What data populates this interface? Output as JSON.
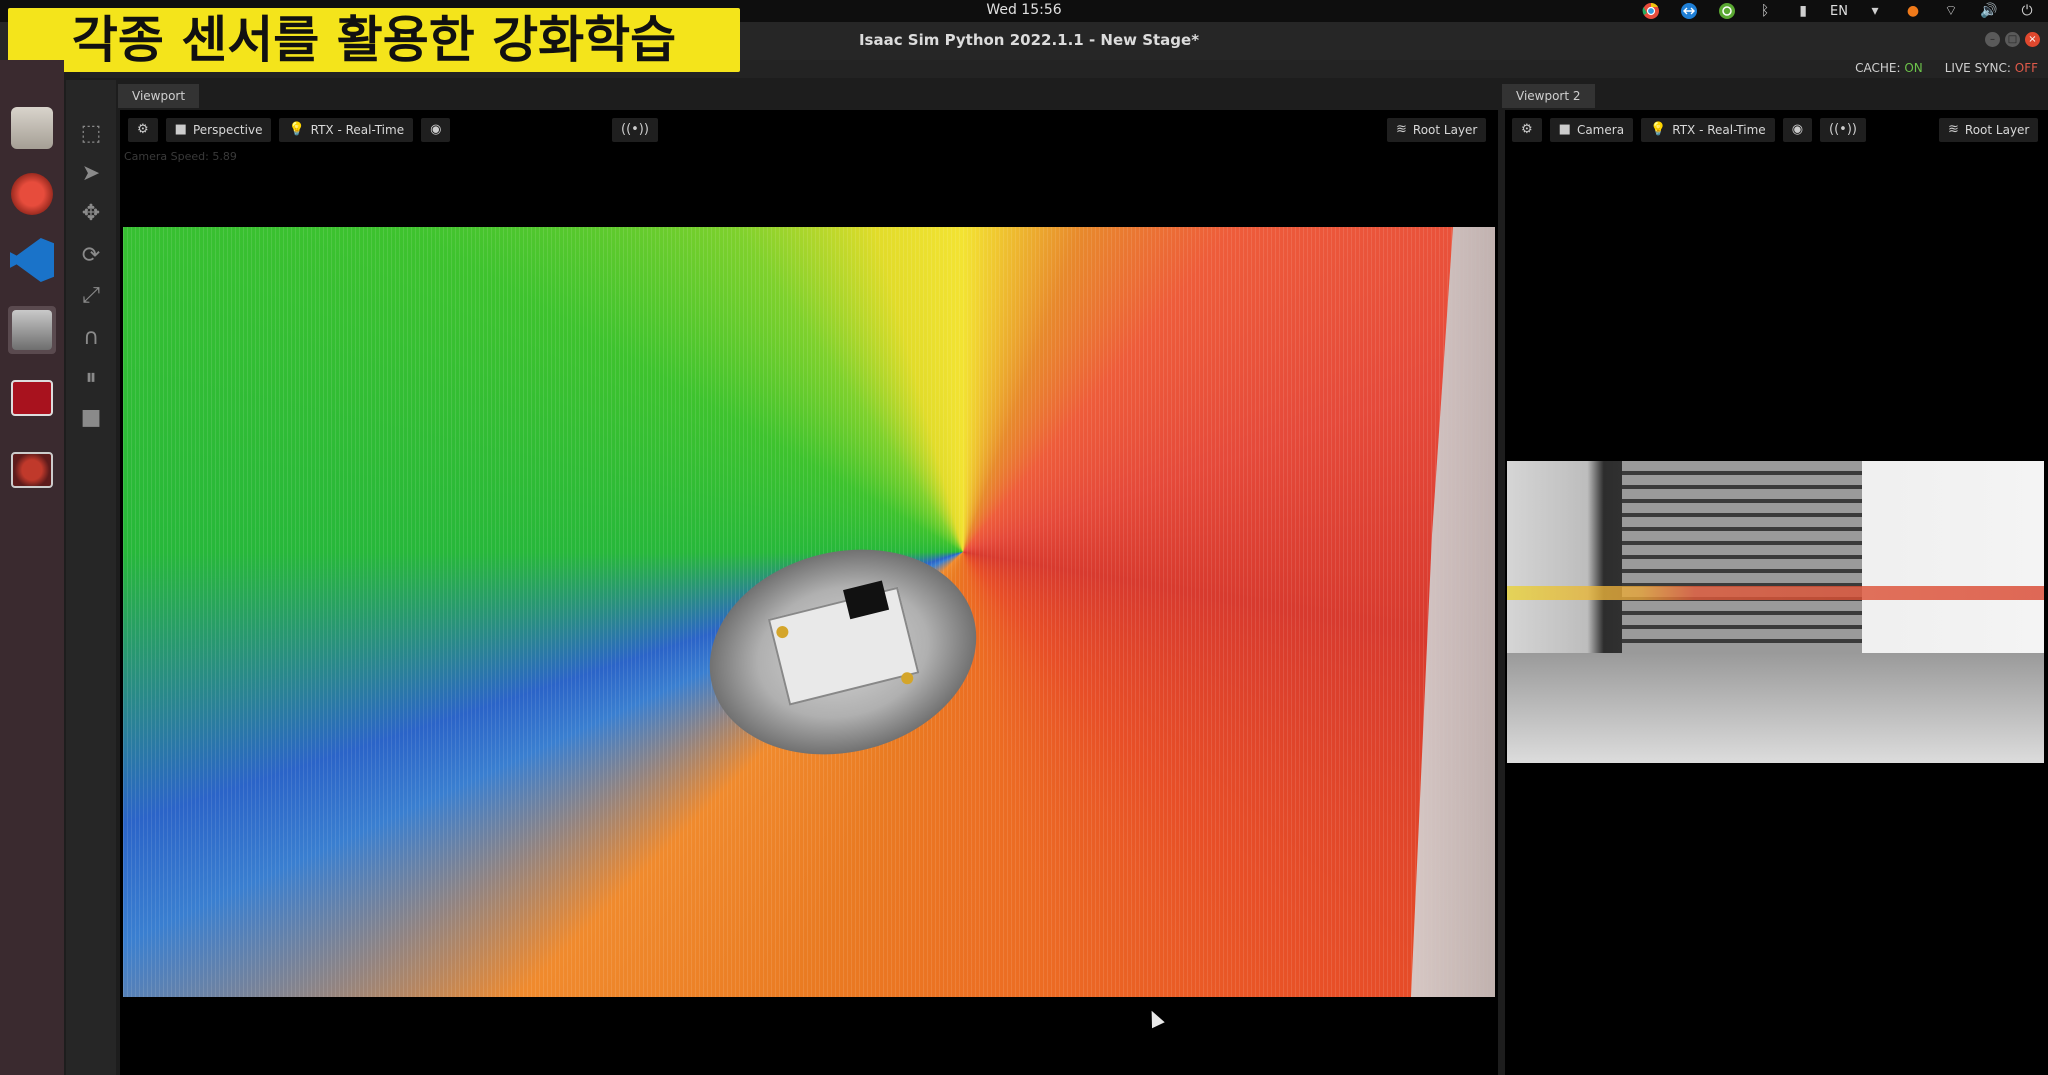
{
  "system": {
    "clock": "Wed 15:56",
    "language": "EN"
  },
  "window": {
    "title": "Isaac Sim Python 2022.1.1 - New Stage*",
    "cache_label": "CACHE:",
    "cache_value": "ON",
    "live_sync_label": "LIVE SYNC:",
    "live_sync_value": "OFF"
  },
  "subtitle": "각종 센서를 활용한 강화학습",
  "viewport1": {
    "tab": "Viewport",
    "camera": "Perspective",
    "renderer": "RTX - Real-Time",
    "layer": "Root Layer",
    "camera_speed": "Camera Speed: 5.89"
  },
  "viewport2": {
    "tab": "Viewport 2",
    "camera": "Camera",
    "renderer": "RTX - Real-Time",
    "layer": "Root Layer"
  },
  "icons": {
    "settings": "gear-icon",
    "camera": "video-camera-icon",
    "light": "lightbulb-icon",
    "visibility": "eye-icon",
    "broadcast": "broadcast-icon",
    "layers": "layers-icon"
  },
  "colors": {
    "banner": "#f4e41b",
    "cache_on": "#6cc24a",
    "live_sync_off": "#e05a4a"
  }
}
